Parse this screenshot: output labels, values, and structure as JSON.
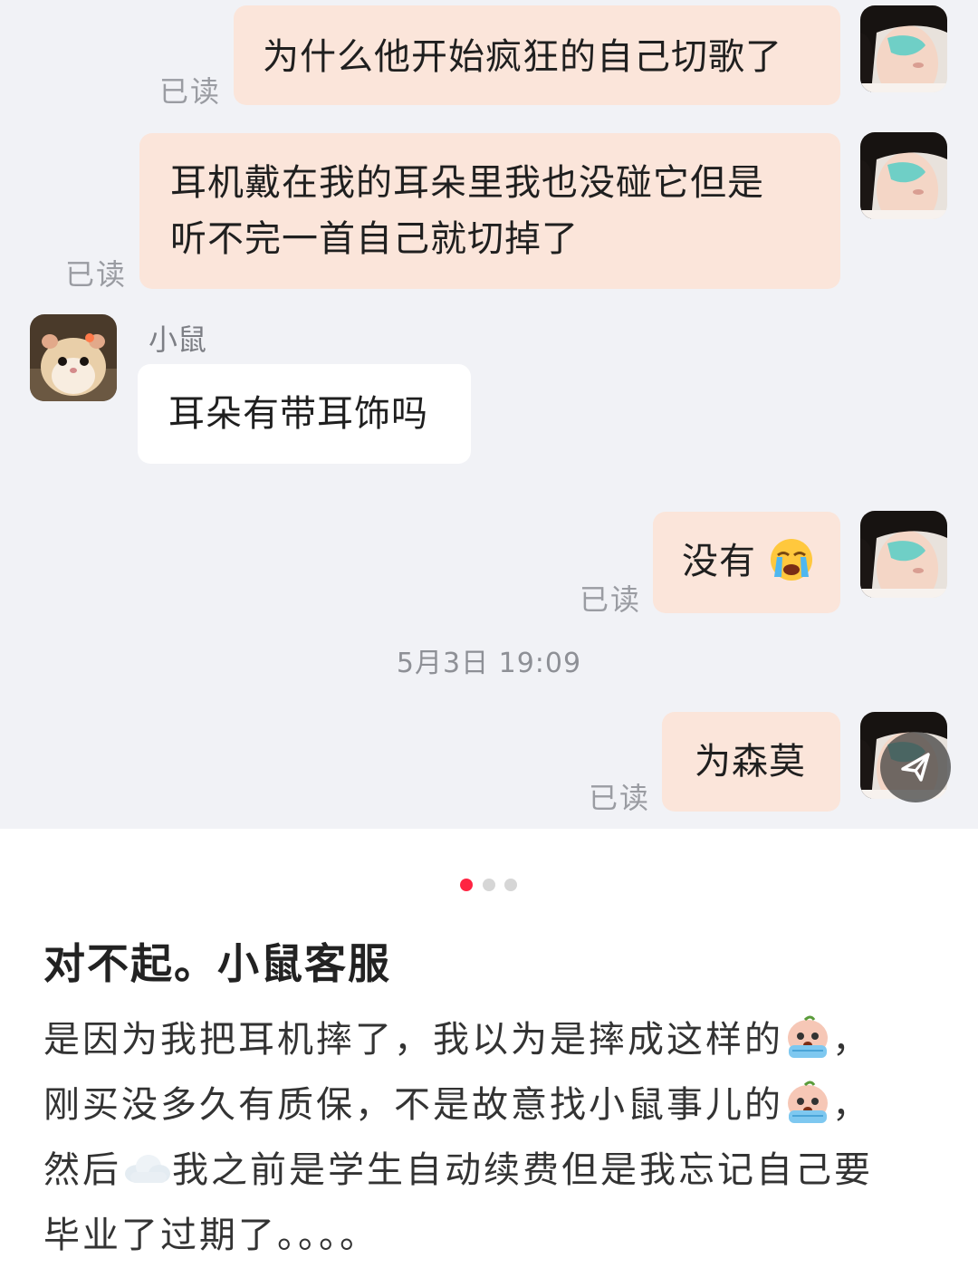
{
  "chat": {
    "messages": [
      {
        "from": "me",
        "text": "为什么他开始疯狂的自己切歌了",
        "status": "已读"
      },
      {
        "from": "me",
        "lines": [
          "耳机戴在我的耳朵里我也没碰它但是",
          "听不完一首自己就切掉了"
        ],
        "status": "已读"
      },
      {
        "from": "other",
        "sender": "小鼠",
        "text": "耳朵有带耳饰吗"
      },
      {
        "from": "me",
        "text": "没有",
        "emoji": "loudly-crying-face-emoji",
        "status": "已读"
      },
      {
        "from": "me",
        "text": "为森莫",
        "status": "已读"
      }
    ],
    "timestamp": "5月3日 19:09",
    "colors": {
      "background": "#f1f2f6",
      "my_bubble": "#fbe5da",
      "their_bubble": "#ffffff",
      "read_receipt": "#9a9ca2"
    }
  },
  "carousel": {
    "count": 3,
    "active_index": 0,
    "active_color": "#ff2442"
  },
  "post": {
    "title": "对不起。小鼠客服",
    "body_lines": [
      "是因为我把耳机摔了，我以为是摔成这样的",
      "，",
      "刚买没多久有质保，不是故意找小鼠事儿的",
      "，",
      "然后",
      "我之前是学生自动续费但是我忘记自己要",
      "毕业了过期了。。。。"
    ]
  },
  "icons": {
    "floating_button": "share-icon",
    "sticker": "crying-peach-sticker",
    "cloud": "cloud-emoji"
  }
}
